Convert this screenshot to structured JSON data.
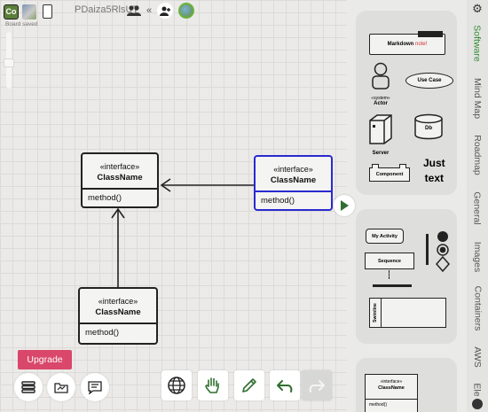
{
  "topbar": {
    "badge": "Co",
    "board_name": "PDaiza5RlsUT",
    "save_status": "Board saved",
    "chevron": "«"
  },
  "canvas": {
    "classes": [
      {
        "stereotype": "«interface»",
        "name": "ClassName",
        "method": "method()"
      },
      {
        "stereotype": "«interface»",
        "name": "ClassName",
        "method": "method()"
      },
      {
        "stereotype": "«interface»",
        "name": "ClassName",
        "method": "method()"
      }
    ]
  },
  "panel": {
    "card1": {
      "markdown_note": "Markdown",
      "markdown_note_suffix": "note!",
      "use_case": "Use Case",
      "actor_stereo": "«system»",
      "actor_label": "Actor",
      "db": "Db",
      "server": "Server",
      "component": "Component",
      "just_text_1": "Just",
      "just_text_2": "text"
    },
    "card2": {
      "activity": "My Activity",
      "sequence": "Sequence",
      "swimline": "Swimline"
    },
    "card3": {
      "stereotype": "«interface»",
      "name": "ClassName",
      "method": "method()"
    }
  },
  "tabs": [
    "Software",
    "Mind Map",
    "Roadmap",
    "General",
    "Images",
    "Containers",
    "AWS",
    "Ele"
  ],
  "bottom": {
    "upgrade_label": "Upgrade"
  },
  "colors": {
    "accent_green": "#2f8a2f",
    "upgrade": "#d9476a",
    "selection": "#2a2ad0",
    "markdown_red": "#d43030"
  }
}
